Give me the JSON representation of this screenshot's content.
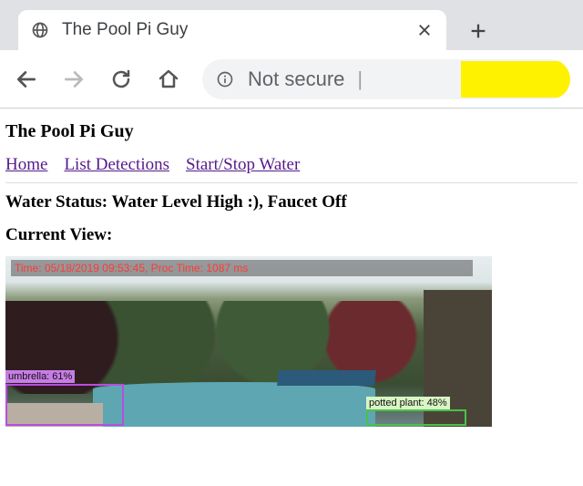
{
  "browser": {
    "tab_title": "The Pool Pi Guy",
    "security_text": "Not secure"
  },
  "page": {
    "title": "The Pool Pi Guy",
    "nav": {
      "home": "Home",
      "list": "List Detections",
      "startstop": "Start/Stop Water"
    },
    "status_line": "Water Status: Water Level High :), Faucet Off",
    "current_view_label": "Current View:",
    "overlay_line": "Time: 05/18/2019 09:53:45, Proc Time: 1087 ms",
    "detections": {
      "umbrella": "umbrella: 61%",
      "potted_plant": "potted plant: 48%"
    }
  }
}
